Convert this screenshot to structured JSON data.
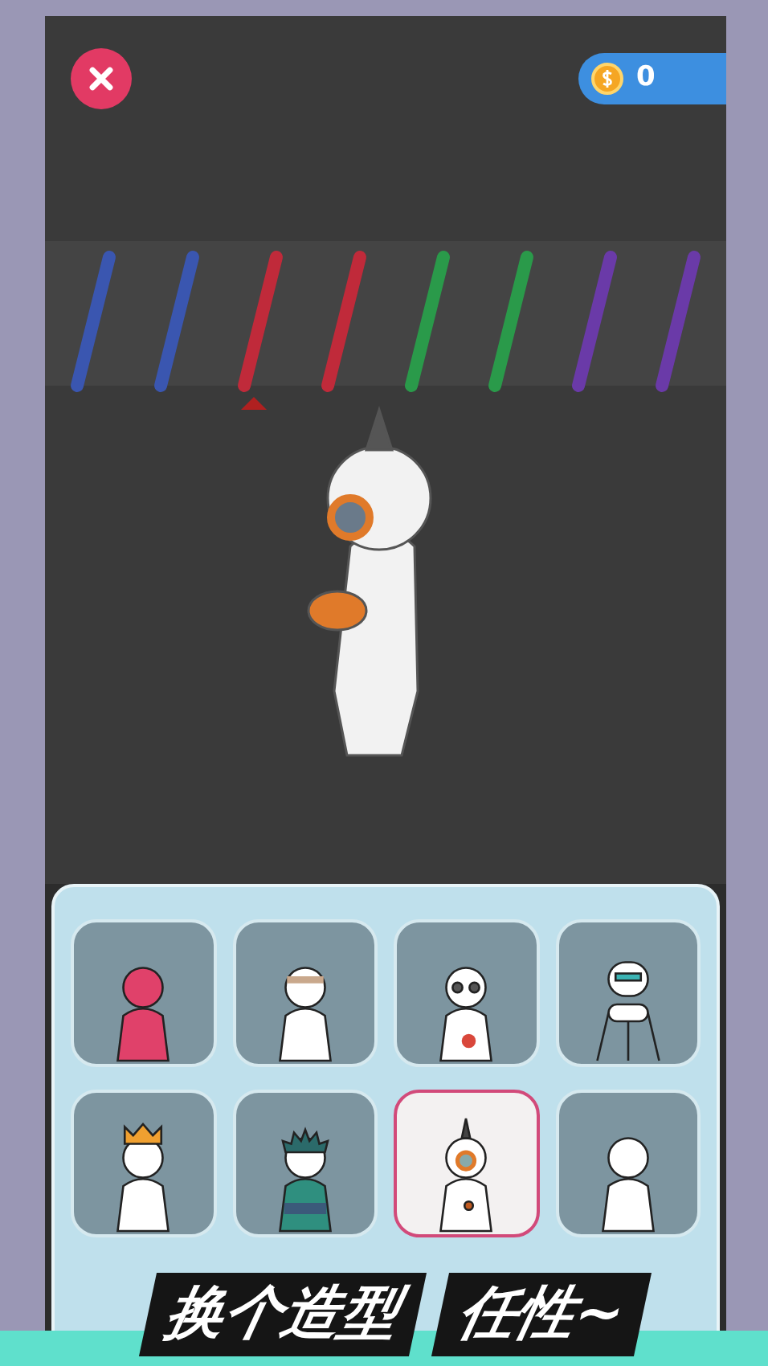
{
  "hud": {
    "coins": "0"
  },
  "skins": [
    {
      "kind": "red",
      "selected": false
    },
    {
      "kind": "bandage",
      "selected": false
    },
    {
      "kind": "skull",
      "selected": false
    },
    {
      "kind": "robot",
      "selected": false
    },
    {
      "kind": "crown",
      "selected": false
    },
    {
      "kind": "spiky",
      "selected": false
    },
    {
      "kind": "astronaut",
      "selected": true
    },
    {
      "kind": "plain",
      "selected": false
    }
  ],
  "banner": {
    "texts": [
      "换个造型",
      "任性~"
    ]
  }
}
